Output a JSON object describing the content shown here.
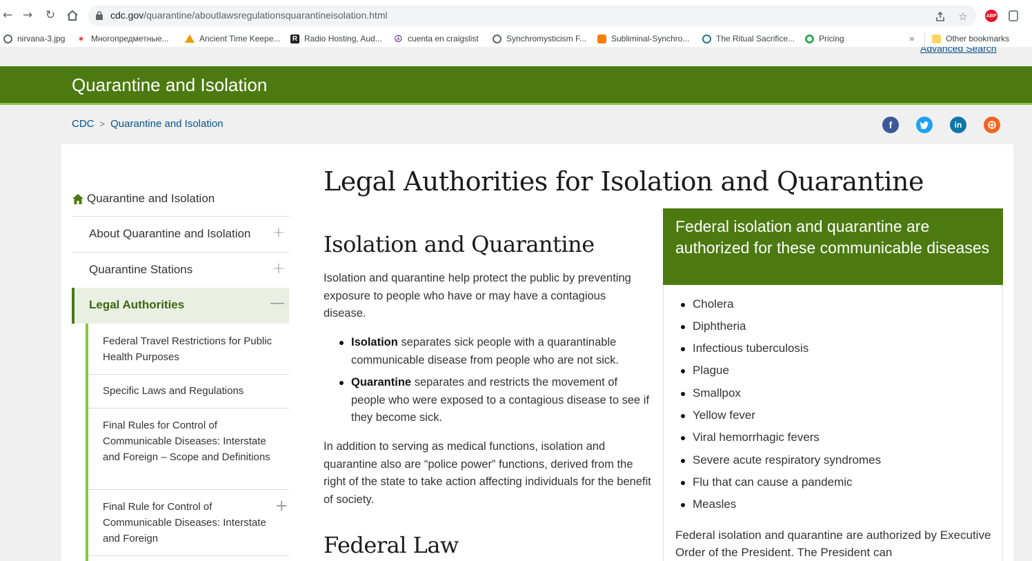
{
  "browser": {
    "url_domain": "cdc.gov",
    "url_path": "/quarantine/aboutlawsregulationsquarantineisolation.html",
    "extension_abp": "ABP",
    "bookmarks": [
      {
        "label": "nirvana-3.jpg",
        "icon": "globe-icon",
        "color": "#5f6368"
      },
      {
        "label": "Многопредметные...",
        "icon": "star-icon",
        "color": "#d93025"
      },
      {
        "label": "Ancient Time Keepe...",
        "icon": "triangle-icon",
        "color": "#f29900"
      },
      {
        "label": "Radio Hosting, Aud...",
        "icon": "r-square-icon",
        "color": "#202124"
      },
      {
        "label": "cuenta en craigslist",
        "icon": "peace-icon",
        "color": "#5b2a86"
      },
      {
        "label": "Synchromysticism F...",
        "icon": "globe-icon",
        "color": "#5f6368"
      },
      {
        "label": "Subliminal-Synchro...",
        "icon": "blogger-icon",
        "color": "#f57d00"
      },
      {
        "label": "The Ritual Sacrifice...",
        "icon": "wordpress-icon",
        "color": "#21759b"
      },
      {
        "label": "Pricing",
        "icon": "circle-icon",
        "color": "#34a853"
      }
    ],
    "more_bookmarks": "»",
    "other_bookmarks": "Other bookmarks"
  },
  "site": {
    "advanced_search": "Advanced Search",
    "banner_title": "Quarantine and Isolation",
    "breadcrumb": [
      "CDC",
      "Quarantine and Isolation"
    ],
    "breadcrumb_sep": ">"
  },
  "sidebar": {
    "home": "Quarantine and Isolation",
    "items": [
      {
        "label": "About Quarantine and Isolation",
        "toggle": "+"
      },
      {
        "label": "Quarantine Stations",
        "toggle": "+"
      },
      {
        "label": "Legal Authorities",
        "toggle": "—"
      }
    ],
    "subitems": [
      {
        "label": "Federal Travel Restrictions for Public Health Purposes"
      },
      {
        "label": "Specific Laws and Regulations"
      },
      {
        "label": "Final Rules for Control of Communicable Diseases: Interstate and Foreign – Scope and Definitions"
      },
      {
        "label": "Final Rule for Control of Communicable Diseases: Interstate and Foreign",
        "toggle": "+"
      }
    ]
  },
  "main": {
    "title": "Legal Authorities for Isolation and Quarantine",
    "section1_title": "Isolation and Quarantine",
    "intro": "Isolation and quarantine help protect the public by preventing exposure to people who have or may have a contagious disease.",
    "bullets": [
      {
        "term": "Isolation",
        "text": " separates sick people with a quarantinable communicable disease from people who are not sick."
      },
      {
        "term": "Quarantine",
        "text": " separates and restricts the movement of people who were exposed to a contagious disease to see if they become sick."
      }
    ],
    "para2": "In addition to serving as medical functions, isolation and quarantine also are “police power” functions, derived from the right of the state to take action affecting individuals for the benefit of society.",
    "section2_title": "Federal Law"
  },
  "diseases_box": {
    "heading": "Federal isolation and quarantine are authorized for these communicable diseases",
    "items": [
      "Cholera",
      "Diphtheria",
      "Infectious tuberculosis",
      "Plague",
      "Smallpox",
      "Yellow fever",
      "Viral hemorrhagic fevers",
      "Severe acute respiratory syndromes",
      "Flu that can cause a pandemic",
      "Measles"
    ],
    "footer": "Federal isolation and quarantine are authorized by Executive Order of the President. The President can"
  },
  "colors": {
    "cdc_green": "#4c7a10",
    "link_blue": "#075290",
    "facebook": "#3b5998",
    "twitter": "#1da1f2",
    "linkedin": "#0e76a8",
    "syndicate": "#f26522"
  }
}
